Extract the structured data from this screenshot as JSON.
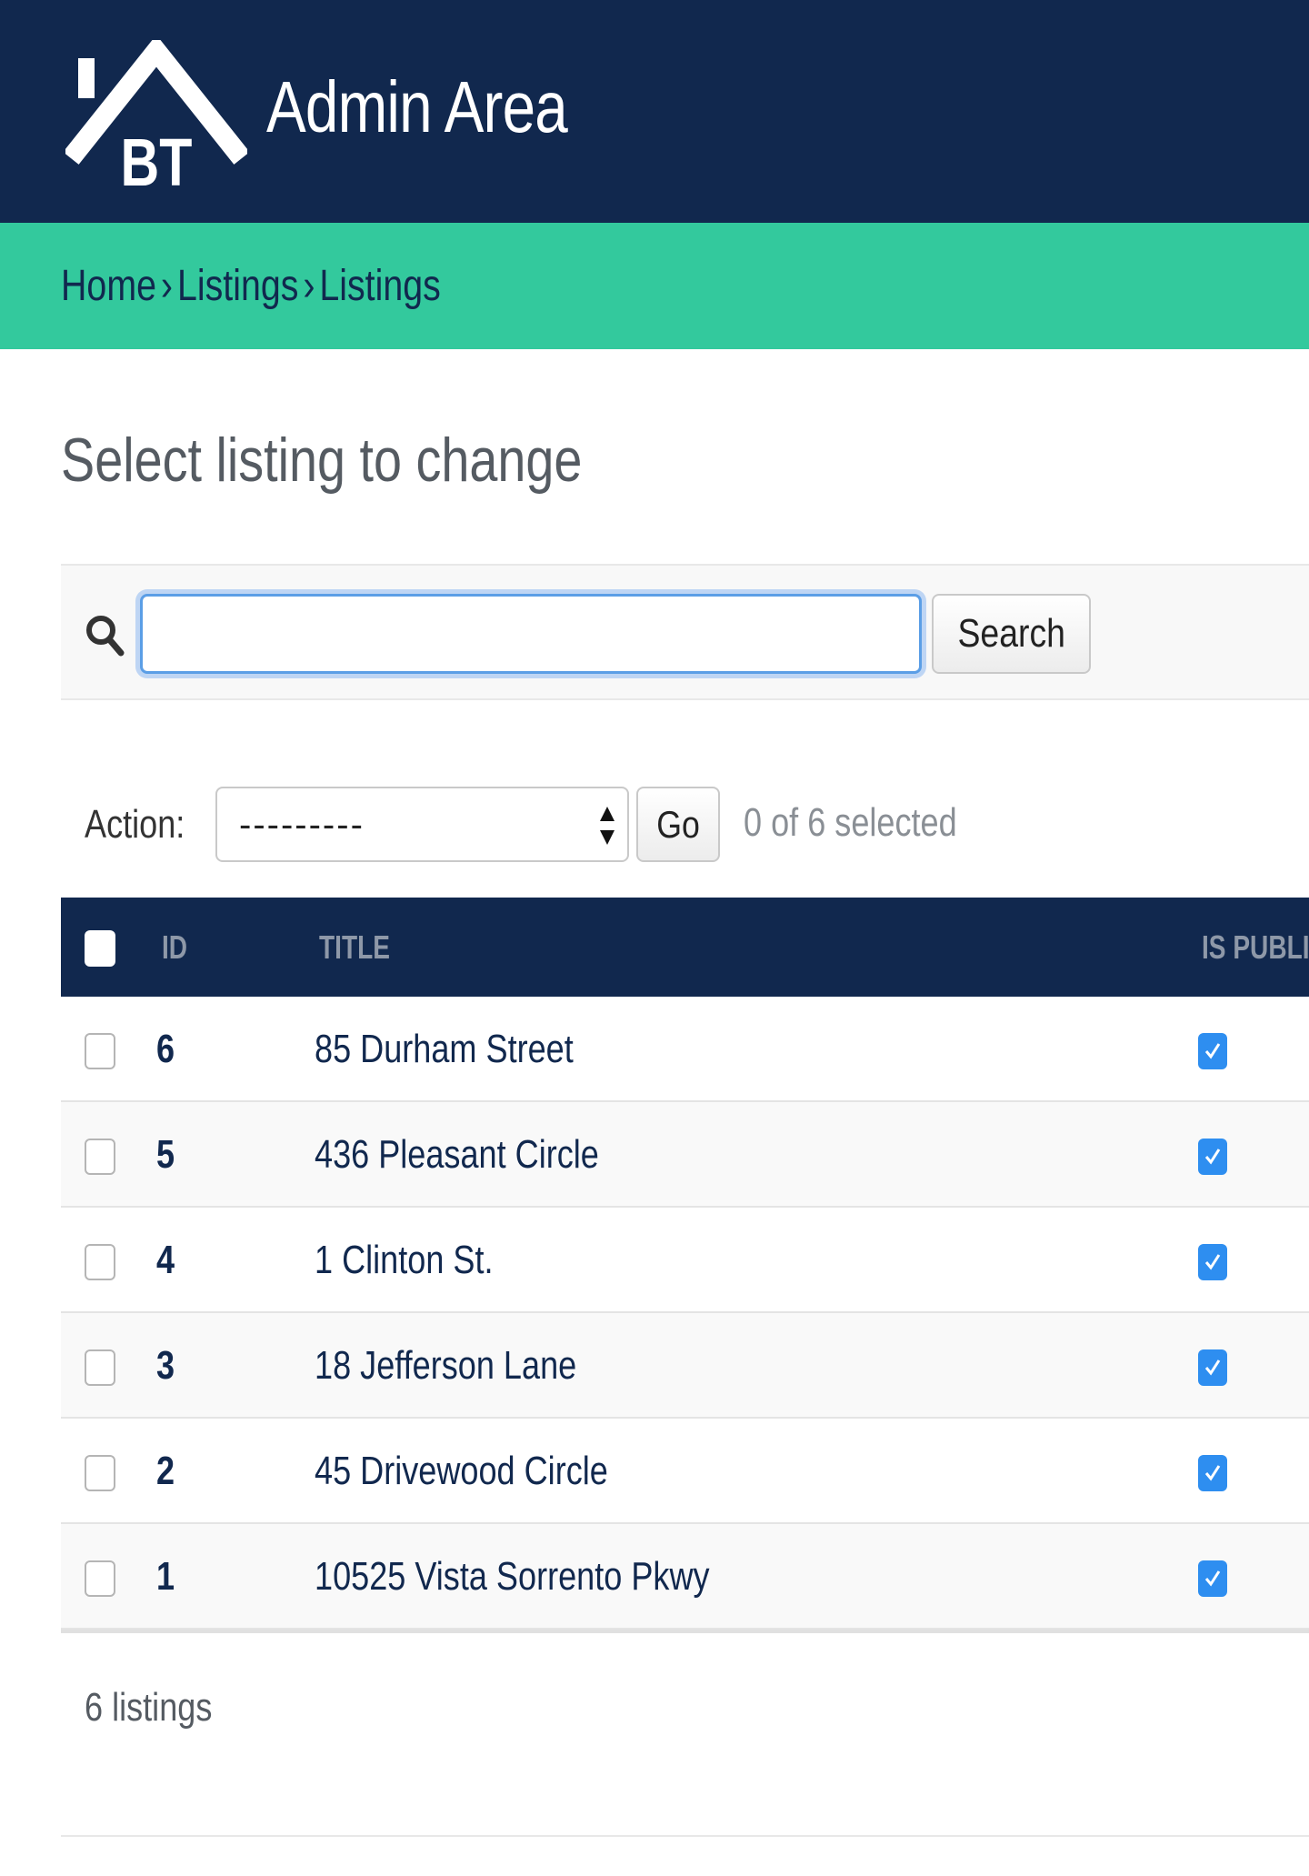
{
  "header": {
    "logo_text": "BT",
    "title": "Admin Area"
  },
  "breadcrumb": {
    "items": [
      "Home",
      "Listings",
      "Listings"
    ],
    "separator": "›"
  },
  "page": {
    "title": "Select listing to change"
  },
  "search": {
    "value": "",
    "placeholder": "",
    "button_label": "Search",
    "icon": "search-icon"
  },
  "actions": {
    "label": "Action:",
    "selected_option": "---------",
    "go_label": "Go",
    "counter": "0 of 6 selected"
  },
  "table": {
    "columns": [
      "ID",
      "TITLE",
      "IS PUBLI"
    ],
    "rows": [
      {
        "id": "6",
        "title": "85 Durham Street",
        "is_published": true,
        "selected": false
      },
      {
        "id": "5",
        "title": "436 Pleasant Circle",
        "is_published": true,
        "selected": false
      },
      {
        "id": "4",
        "title": "1 Clinton St.",
        "is_published": true,
        "selected": false
      },
      {
        "id": "3",
        "title": "18 Jefferson Lane",
        "is_published": true,
        "selected": false
      },
      {
        "id": "2",
        "title": "45 Drivewood Circle",
        "is_published": true,
        "selected": false
      },
      {
        "id": "1",
        "title": "10525 Vista Sorrento Pkwy",
        "is_published": true,
        "selected": false
      }
    ]
  },
  "paginator": {
    "text": "6 listings"
  },
  "colors": {
    "header_bg": "#11284e",
    "breadcrumb_bg": "#33c99d",
    "checkbox_checked": "#2e8ef0",
    "focus_ring": "#5b9ee6"
  }
}
